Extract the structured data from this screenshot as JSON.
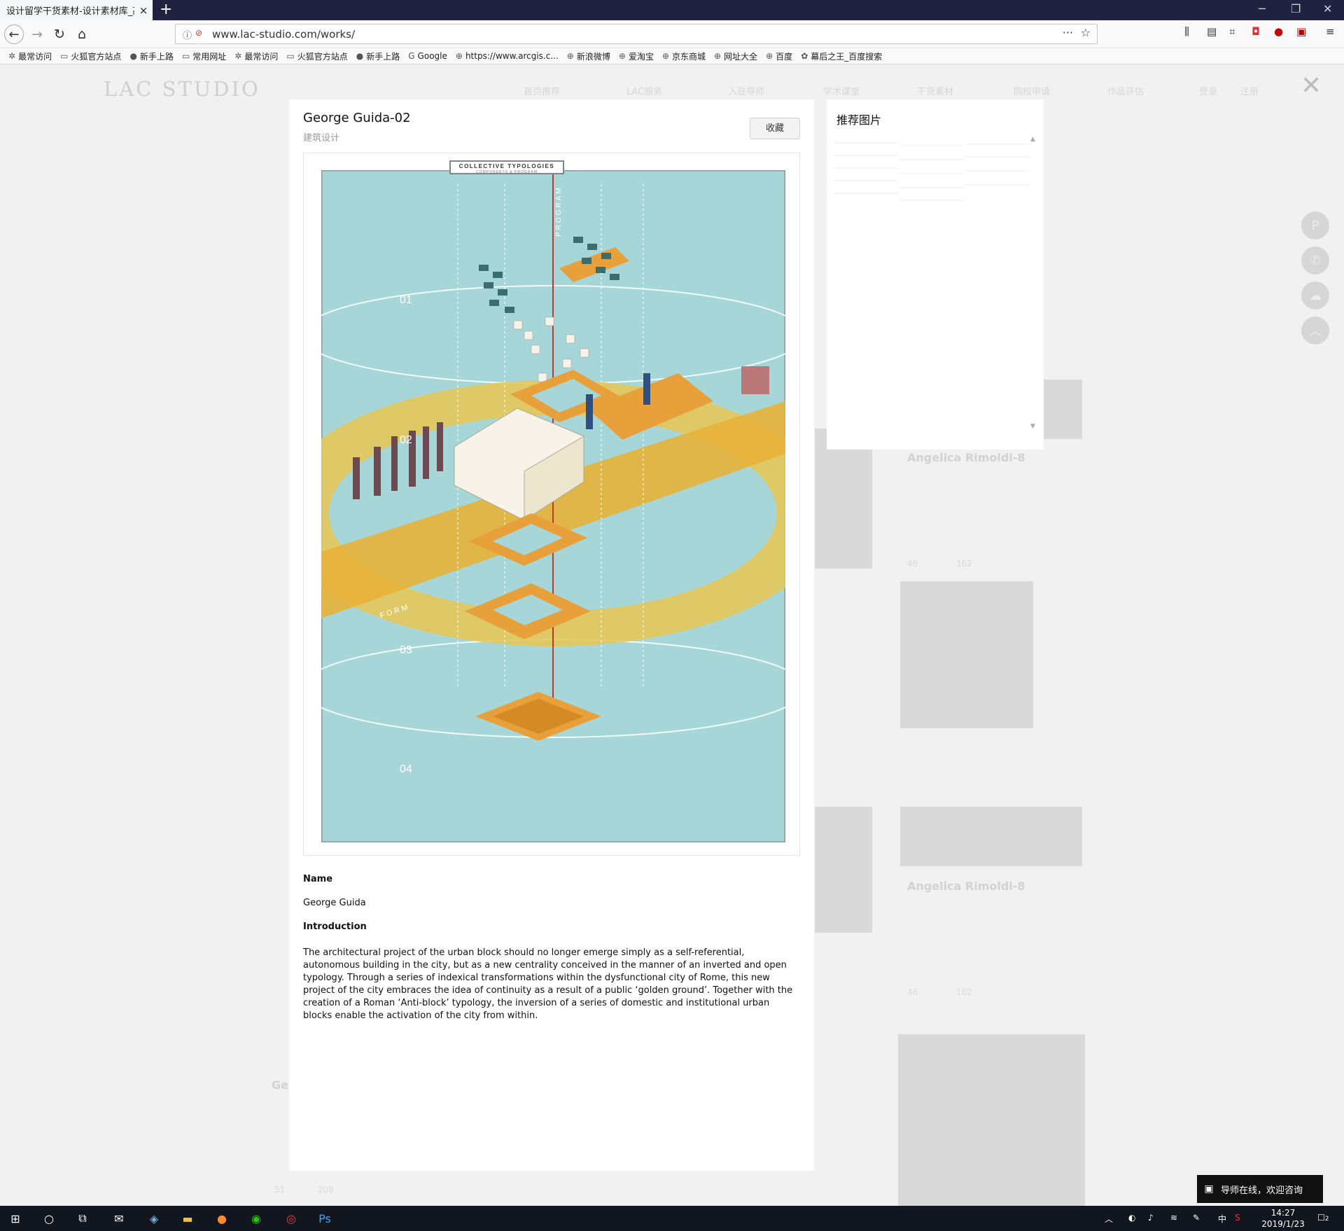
{
  "browser": {
    "tab_title": "设计留学干货素材-设计素材库_高...",
    "tab_close": "×",
    "new_tab": "+",
    "url": "www.lac-studio.com/works/",
    "bookmarks": [
      {
        "label": "最常访问",
        "icon": "gear-icon"
      },
      {
        "label": "火狐官方站点",
        "icon": "folder-icon"
      },
      {
        "label": "新手上路",
        "icon": "firefox-icon"
      },
      {
        "label": "常用网址",
        "icon": "folder-icon"
      },
      {
        "label": "最常访问",
        "icon": "gear-icon"
      },
      {
        "label": "火狐官方站点",
        "icon": "folder-icon"
      },
      {
        "label": "新手上路",
        "icon": "firefox-icon"
      },
      {
        "label": "Google",
        "icon": "google-icon"
      },
      {
        "label": "https://www.arcgis.c...",
        "icon": "globe-icon"
      },
      {
        "label": "新浪微博",
        "icon": "globe-icon"
      },
      {
        "label": "爱淘宝",
        "icon": "globe-icon"
      },
      {
        "label": "京东商城",
        "icon": "globe-icon"
      },
      {
        "label": "网址大全",
        "icon": "globe-icon"
      },
      {
        "label": "百度",
        "icon": "globe-icon"
      },
      {
        "label": "幕后之王_百度搜索",
        "icon": "baidu-icon"
      }
    ]
  },
  "background_page": {
    "logo": "LAC STUDIO",
    "nav": [
      "首页推荐",
      "LAC服务",
      "入驻导师",
      "学术课堂",
      "干货素材",
      "院校申请",
      "作品评估",
      "登录",
      "注册"
    ],
    "card_title": "Angelica Rimoldi-8",
    "card_likes": "46",
    "card_views": "162",
    "card_likes_2": "51",
    "card_views_2": "208",
    "card_title_2": "Ge"
  },
  "modal": {
    "title": "George Guida-02",
    "subtitle": "建筑设计",
    "favorite_button": "收藏",
    "poster_title": "COLLECTIVE TYPOLOGIES",
    "poster_subtitle": "COMPONENTS & PROGRAM",
    "poster_program_label": "PROGRAM",
    "poster_form_label": "FORM",
    "poster_levels": [
      "01",
      "02",
      "03",
      "04"
    ],
    "name_label": "Name",
    "name_value": "George Guida",
    "intro_label": "Introduction",
    "intro_text": "The architectural project of the urban block should no longer emerge simply as a self-referential, autonomous building in the city, but as a new centrality conceived in the manner of an inverted and open typology. Through a series of indexical transformations within the dysfunctional city of Rome, this new project of the city embraces the idea of continuity as a result of a public ‘golden ground’. Together with the creation of a Roman ‘Anti-block’ typology, the inversion of a series of domestic and institutional urban blocks enable the activation of the city from within."
  },
  "side_panel": {
    "title": "推荐图片"
  },
  "chat": {
    "label": "导师在线，欢迎咨询"
  },
  "taskbar": {
    "time": "14:27",
    "date": "2019/1/23",
    "ime": "中",
    "notification_count": "2"
  },
  "colors": {
    "tabbar": "#202340",
    "poster_sky": "#a6d6d8",
    "poster_gold": "#e8b23a",
    "poster_ring": "#e6c65a",
    "chat_bg": "#111111",
    "taskbar": "#12161f"
  }
}
